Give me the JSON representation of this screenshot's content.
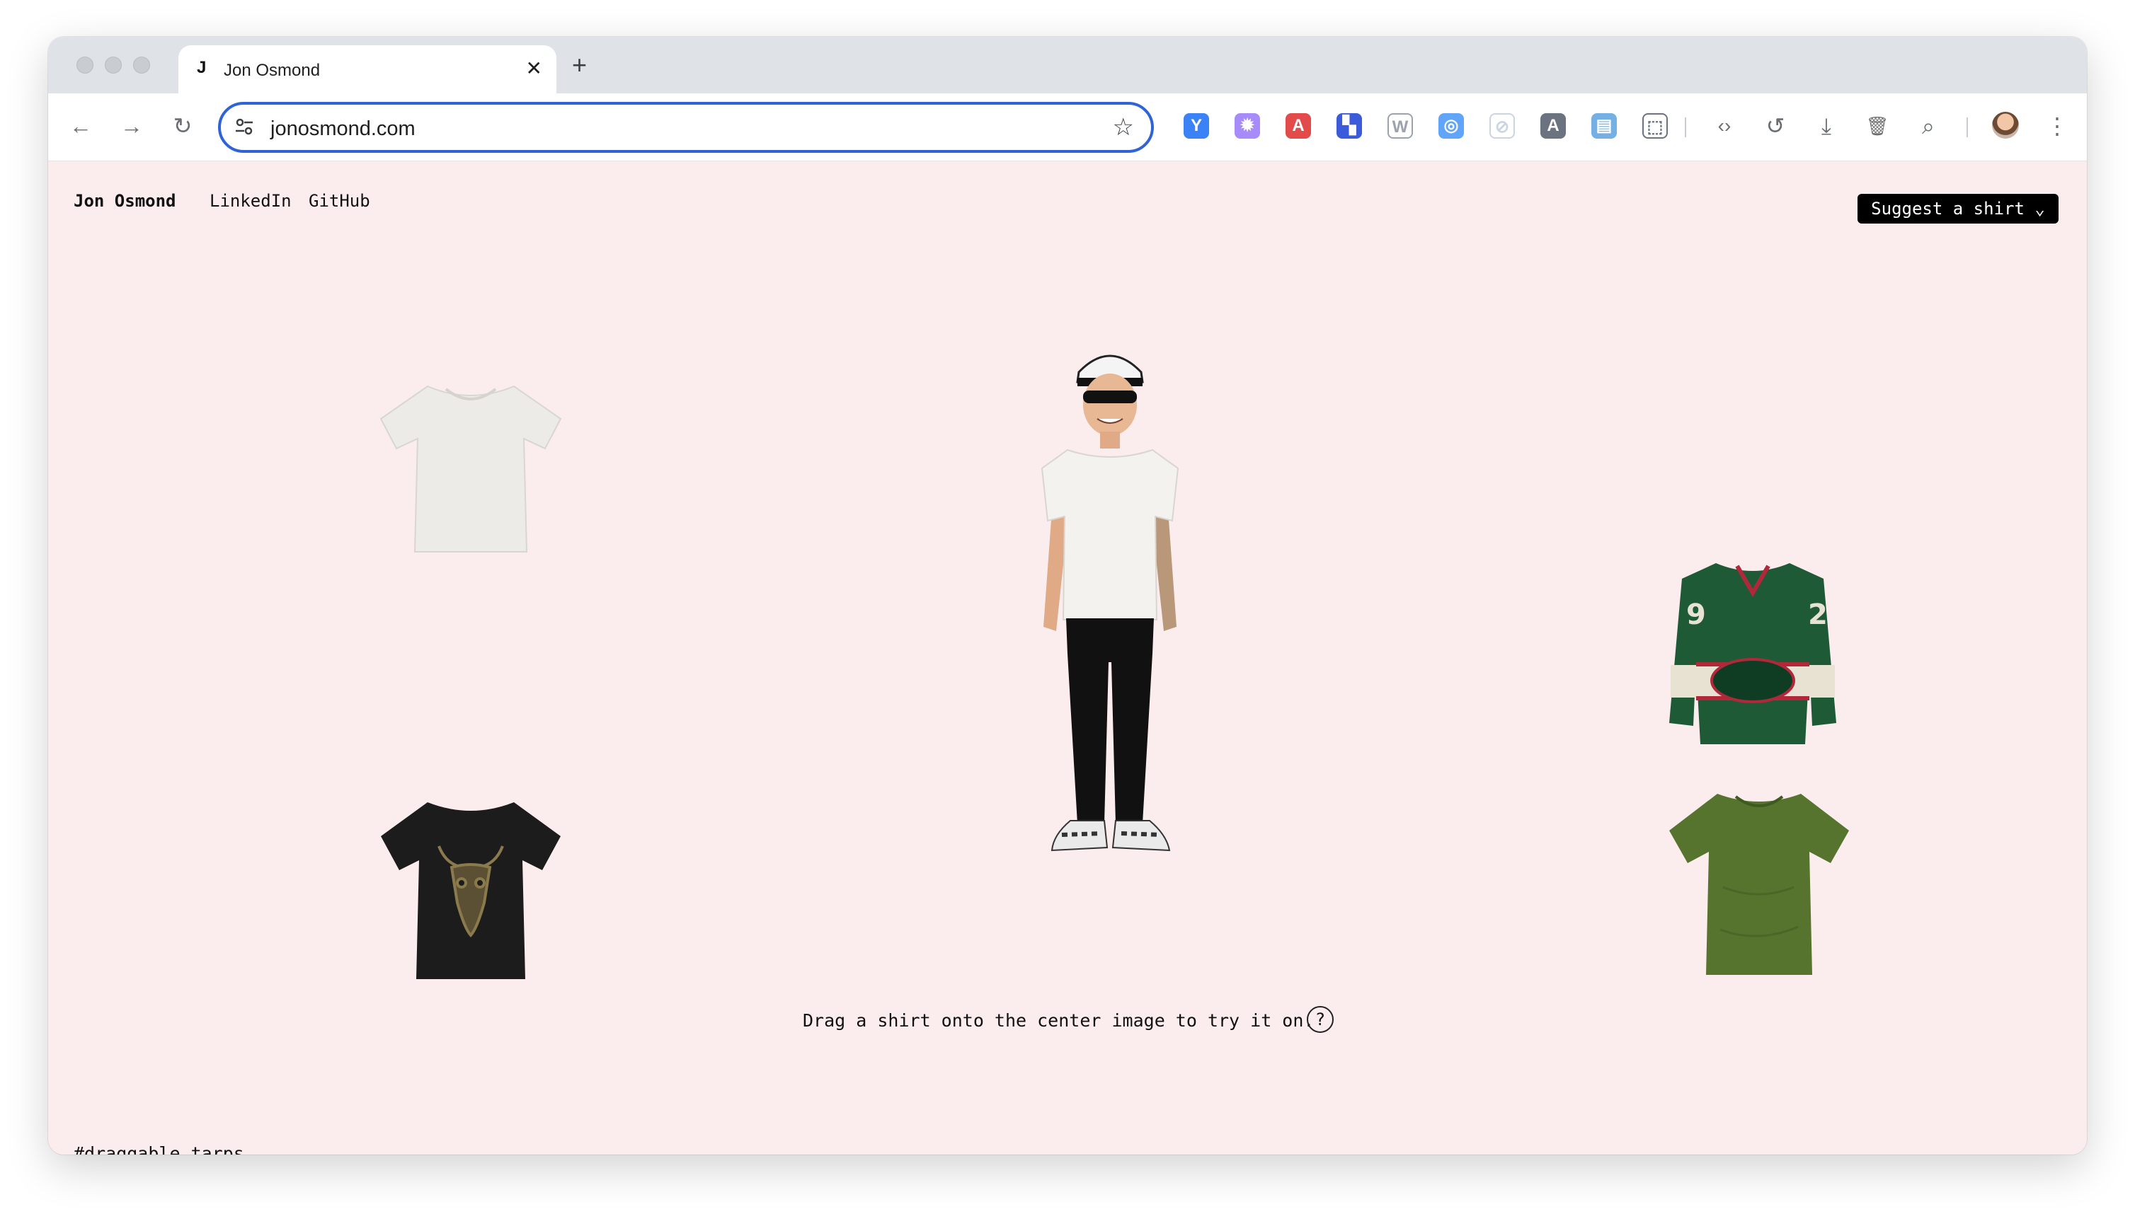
{
  "browser": {
    "tab": {
      "favicon": "J",
      "title": "Jon Osmond",
      "close": "✕"
    },
    "new_tab": "+",
    "nav": {
      "back": "←",
      "forward": "→",
      "reload": "↻"
    },
    "address": {
      "url": "jonosmond.com",
      "site_info_icon": "tune-icon",
      "bookmark_icon": "star-icon"
    },
    "extensions": [
      {
        "name": "filter-extension-icon",
        "glyph": "Y",
        "color": "#3b82f6"
      },
      {
        "name": "gear-extension-icon",
        "glyph": "✹",
        "color": "#a78bfa"
      },
      {
        "name": "a-extension-icon",
        "glyph": "A",
        "color": "#e34b4b"
      },
      {
        "name": "grid-extension-icon",
        "glyph": "▚",
        "color": "#3b5bdb"
      },
      {
        "name": "w-extension-icon",
        "glyph": "W",
        "color": "#9ca3af"
      },
      {
        "name": "owl-extension-icon",
        "glyph": "◎",
        "color": "#60a5fa"
      },
      {
        "name": "compass-extension-icon",
        "glyph": "⊘",
        "color": "#cbd5e1"
      },
      {
        "name": "a-box-extension-icon",
        "glyph": "A",
        "color": "#6b7280"
      },
      {
        "name": "reader-extension-icon",
        "glyph": "▤",
        "color": "#74b0e3"
      },
      {
        "name": "puzzle-icon",
        "glyph": "⬚",
        "color": "#6b7280"
      }
    ],
    "toolbar_right": {
      "code_icon": "‹›",
      "history_icon": "↺",
      "download_icon": "⤓",
      "trash_icon": "🗑",
      "search_tab_icon": "⌕",
      "menu_icon": "⋮"
    }
  },
  "page": {
    "site_name": "Jon Osmond",
    "nav_links": [
      "LinkedIn",
      "GitHub"
    ],
    "suggest_button": "Suggest a shirt ⌄",
    "instructions": "Drag a shirt onto the center image to try it on.",
    "help": "?",
    "tags": "#draggable tarps",
    "shirts": [
      {
        "name": "white-tshirt",
        "color": "#ecebe7"
      },
      {
        "name": "black-bull-skull-tshirt",
        "color": "#1c1c1c"
      },
      {
        "name": "wild-hockey-jersey",
        "color": "#1f5a36"
      },
      {
        "name": "olive-green-tshirt",
        "color": "#56742e"
      }
    ],
    "jersey_numbers": [
      "9",
      "2"
    ]
  }
}
